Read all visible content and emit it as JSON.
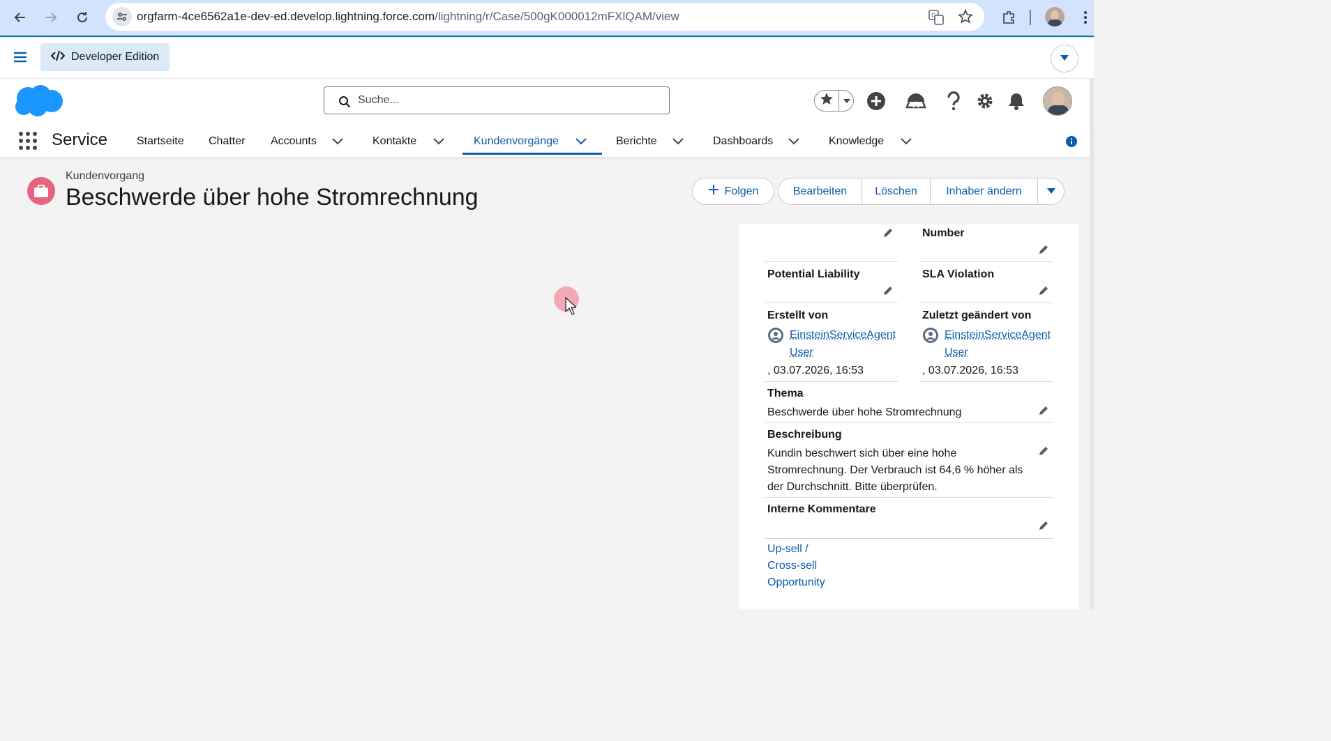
{
  "browser": {
    "url_host": "orgfarm-4ce6562a1e-dev-ed.develop.lightning.force.com",
    "url_path": "/lightning/r/Case/500gK000012mFXlQAM/view"
  },
  "devbar": {
    "label": "Developer Edition"
  },
  "header": {
    "search_placeholder": "Suche..."
  },
  "nav": {
    "app_name": "Service",
    "items": [
      {
        "label": "Startseite"
      },
      {
        "label": "Chatter"
      },
      {
        "label": "Accounts"
      },
      {
        "label": "Kontakte"
      },
      {
        "label": "Kundenvorgänge"
      },
      {
        "label": "Berichte"
      },
      {
        "label": "Dashboards"
      },
      {
        "label": "Knowledge"
      }
    ]
  },
  "record": {
    "type": "Kundenvorgang",
    "title": "Beschwerde über hohe Stromrechnung",
    "actions": {
      "follow": "Folgen",
      "edit": "Bearbeiten",
      "delete": "Löschen",
      "change_owner": "Inhaber ändern"
    }
  },
  "details": {
    "number_label": "Number",
    "potential_liability_label": "Potential Liability",
    "sla_violation_label": "SLA Violation",
    "created_by_label": "Erstellt von",
    "created_by_user_line1": "EinsteinServiceAgent",
    "created_by_user_line2": "User",
    "created_by_date": ", 03.07.2026, 16:53",
    "modified_by_label": "Zuletzt geändert von",
    "modified_by_user_line1": "EinsteinServiceAgent",
    "modified_by_user_line2": "User",
    "modified_by_date": ", 03.07.2026, 16:53",
    "subject_label": "Thema",
    "subject_value": "Beschwerde über hohe Stromrechnung",
    "description_label": "Beschreibung",
    "description_line1": "Kundin beschwert sich über eine hohe",
    "description_line2": "Stromrechnung. Der Verbrauch ist 64,6 % höher als",
    "description_line3": "der Durchschnitt. Bitte überprüfen.",
    "internal_comments_label": "Interne Kommentare",
    "upsell_line1": "Up-sell /",
    "upsell_line2": "Cross-sell",
    "upsell_line3": "Opportunity"
  },
  "colors": {
    "brand_blue": "#0b5cab",
    "case_icon": "#e8637f",
    "chrome_bg": "#d3e3fd"
  }
}
